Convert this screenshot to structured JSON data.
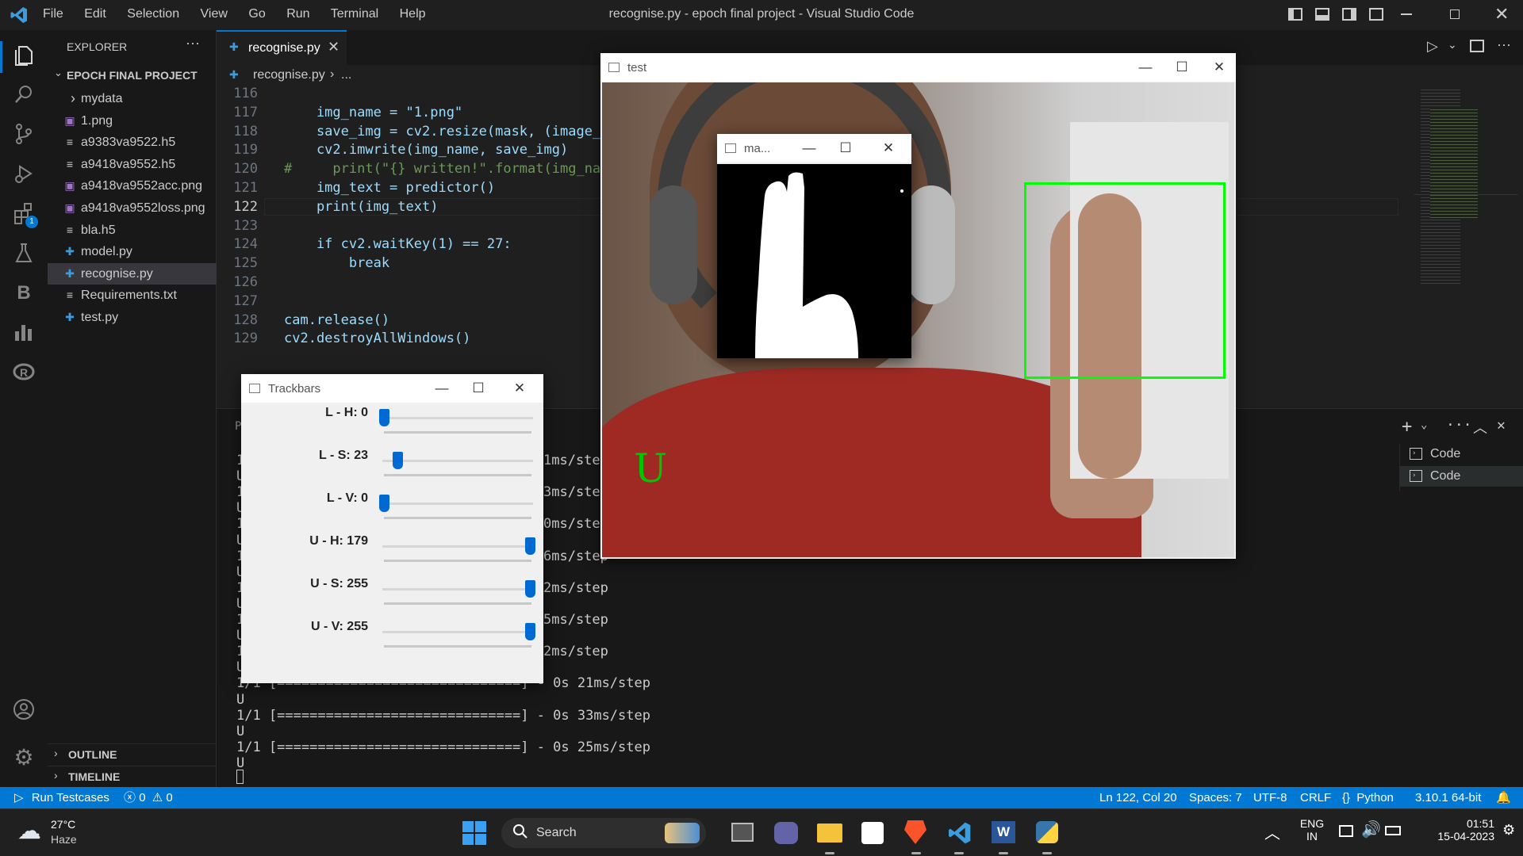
{
  "titlebar": {
    "menu": [
      "File",
      "Edit",
      "Selection",
      "View",
      "Go",
      "Run",
      "Terminal",
      "Help"
    ],
    "title": "recognise.py - epoch final project - Visual Studio Code"
  },
  "sidebar": {
    "header": "EXPLORER",
    "project": "EPOCH FINAL PROJECT",
    "files": [
      {
        "name": "mydata",
        "icon": "chevron-right-icon"
      },
      {
        "name": "1.png",
        "icon": "image-icon"
      },
      {
        "name": "a9383va9522.h5",
        "icon": "file-lines-icon"
      },
      {
        "name": "a9418va9552.h5",
        "icon": "file-lines-icon"
      },
      {
        "name": "a9418va9552acc.png",
        "icon": "image-icon"
      },
      {
        "name": "a9418va9552loss.png",
        "icon": "image-icon"
      },
      {
        "name": "bla.h5",
        "icon": "file-lines-icon"
      },
      {
        "name": "model.py",
        "icon": "python-icon"
      },
      {
        "name": "recognise.py",
        "icon": "python-icon"
      },
      {
        "name": "Requirements.txt",
        "icon": "file-lines-icon"
      },
      {
        "name": "test.py",
        "icon": "python-icon"
      }
    ],
    "outline": "OUTLINE",
    "timeline": "TIMELINE",
    "extensions_badge": "1"
  },
  "editor": {
    "tab": "recognise.py",
    "breadcrumb_file": "recognise.py",
    "breadcrumb_more": "...",
    "lines": [
      {
        "num": "116",
        "code": ""
      },
      {
        "num": "117",
        "code": "    img_name = \"1.png\""
      },
      {
        "num": "118",
        "code": "    save_img = cv2.resize(mask, (image_x,"
      },
      {
        "num": "119",
        "code": "    cv2.imwrite(img_name, save_img)"
      },
      {
        "num": "120",
        "code": "#     print(\"{} written!\".format(img_name)"
      },
      {
        "num": "121",
        "code": "    img_text = predictor()"
      },
      {
        "num": "122",
        "code": "    print(img_text)"
      },
      {
        "num": "123",
        "code": ""
      },
      {
        "num": "124",
        "code": "    if cv2.waitKey(1) == 27:"
      },
      {
        "num": "125",
        "code": "        break"
      },
      {
        "num": "126",
        "code": ""
      },
      {
        "num": "127",
        "code": ""
      },
      {
        "num": "128",
        "code": "cam.release()"
      },
      {
        "num": "129",
        "code": "cv2.destroyAllWindows()"
      }
    ]
  },
  "terminal": {
    "panel_prefix": "P",
    "lines": [
      {
        "left": "1",
        "right": "1ms/step"
      },
      {
        "left": "U",
        "right": ""
      },
      {
        "left": "1",
        "right": "3ms/step"
      },
      {
        "left": "U",
        "right": ""
      },
      {
        "left": "1",
        "right": "0ms/step"
      },
      {
        "left": "U",
        "right": ""
      },
      {
        "left": "1",
        "right": "6ms/step"
      },
      {
        "left": "U",
        "right": ""
      },
      {
        "left": "1",
        "right": "2ms/step"
      },
      {
        "left": "U",
        "right": ""
      },
      {
        "left": "1",
        "right": "5ms/step"
      },
      {
        "left": "U",
        "right": ""
      },
      {
        "left": "1",
        "right": "2ms/step"
      },
      {
        "left": "U",
        "right": ""
      },
      {
        "left": "1/1 [==============================] - 0s 21ms/step",
        "right": ""
      },
      {
        "left": "U",
        "right": ""
      },
      {
        "left": "1/1 [==============================] - 0s 33ms/step",
        "right": ""
      },
      {
        "left": "U",
        "right": ""
      },
      {
        "left": "1/1 [==============================] - 0s 25ms/step",
        "right": ""
      },
      {
        "left": "U",
        "right": ""
      }
    ],
    "sessions": [
      "Code",
      "Code"
    ]
  },
  "statusbar": {
    "run": "Run Testcases",
    "errors": "0",
    "warnings": "0",
    "position": "Ln 122, Col 20",
    "spaces": "Spaces: 7",
    "encoding": "UTF-8",
    "eol": "CRLF",
    "language": "Python",
    "interpreter": "3.10.1 64-bit"
  },
  "windows": {
    "test_title": "test",
    "mask_title": "ma...",
    "trackbars_title": "Trackbars",
    "predicted_letter": "U",
    "box_color": "#00ff00"
  },
  "trackbars": [
    {
      "label": "L - H: 0",
      "value": 0,
      "max": 179
    },
    {
      "label": "L - S: 23",
      "value": 23,
      "max": 255
    },
    {
      "label": "L - V: 0",
      "value": 0,
      "max": 255
    },
    {
      "label": "U - H: 179",
      "value": 179,
      "max": 179
    },
    {
      "label": "U - S: 255",
      "value": 255,
      "max": 255
    },
    {
      "label": "U - V: 255",
      "value": 255,
      "max": 255
    }
  ],
  "taskbar": {
    "temp": "27°C",
    "weather": "Haze",
    "search": "Search",
    "lang1": "ENG",
    "lang2": "IN",
    "time": "01:51",
    "date": "15-04-2023"
  }
}
